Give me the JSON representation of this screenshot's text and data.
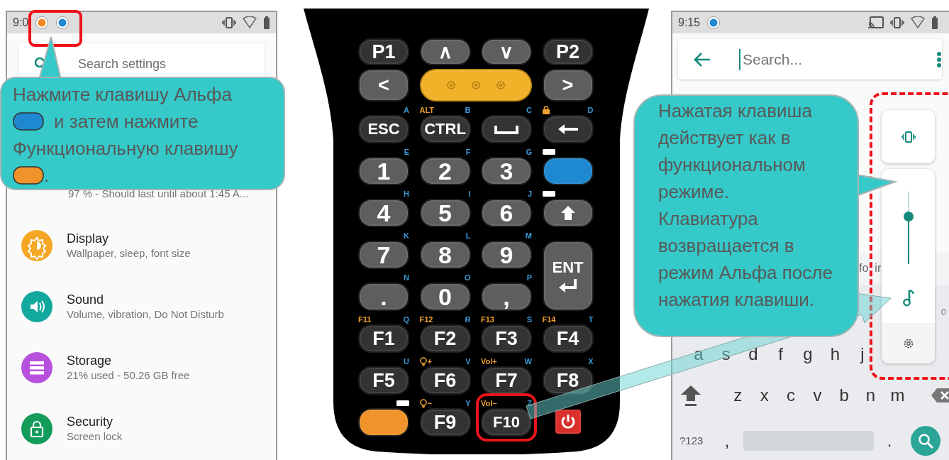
{
  "left_screen": {
    "status_bar": {
      "time": "9:0",
      "icons_highlighted": true
    },
    "search": {
      "placeholder": "Search settings"
    },
    "battery_summary": "97 % - Should last until about 1:45 A...",
    "settings": [
      {
        "kind": "display",
        "title": "Display",
        "subtitle": "Wallpaper, sleep, font size",
        "color": "#f5a623"
      },
      {
        "kind": "sound",
        "title": "Sound",
        "subtitle": "Volume, vibration, Do Not Disturb",
        "color": "#13a89e"
      },
      {
        "kind": "storage",
        "title": "Storage",
        "subtitle": "21% used - 50.26 GB free",
        "color": "#b751dd"
      },
      {
        "kind": "security",
        "title": "Security",
        "subtitle": "Screen lock",
        "color": "#149c5a"
      }
    ]
  },
  "callout_left": {
    "parts": [
      {
        "kind": "text",
        "text": "Нажмите клавишу Альфа"
      },
      {
        "kind": "key",
        "color": "#1e88d0"
      },
      {
        "kind": "text",
        "text": "и затем нажмите"
      },
      {
        "kind": "text",
        "text": "Функциональную клавишу"
      },
      {
        "kind": "key",
        "color": "#f0932b"
      },
      {
        "kind": "text",
        "text": "."
      }
    ]
  },
  "keypad": {
    "rows": [
      [
        {
          "kind": "text",
          "color": "#333333",
          "label": "P1"
        },
        {
          "kind": "text",
          "color": "#5e5e5e",
          "label": "∧"
        },
        {
          "kind": "text",
          "color": "#5e5e5e",
          "label": "∨"
        },
        {
          "kind": "text",
          "color": "#333333",
          "label": "P2"
        }
      ],
      [
        {
          "kind": "text",
          "color": "#5e5e5e",
          "label": "<"
        },
        {
          "kind": "grille",
          "color": "#f1b22a"
        },
        "",
        {
          "kind": "text",
          "color": "#5e5e5e",
          "label": ">"
        }
      ],
      [
        {
          "kind": "text",
          "color": "#333333",
          "label": "ESC",
          "letter": "A"
        },
        {
          "kind": "text",
          "color": "#333333",
          "label": "CTRL",
          "fn": "ALT",
          "letter": "B"
        },
        {
          "kind": "space",
          "color": "#333333",
          "letter": "C"
        },
        {
          "kind": "backspace",
          "color": "#333333",
          "lock": true,
          "letter": "D"
        }
      ],
      [
        {
          "kind": "text",
          "color": "#5e5e5e",
          "label": "1",
          "letter": "E"
        },
        {
          "kind": "text",
          "color": "#5e5e5e",
          "label": "2",
          "letter": "F"
        },
        {
          "kind": "text",
          "color": "#5e5e5e",
          "label": "3",
          "letter": "G"
        },
        {
          "kind": "blank",
          "color": "#1e88d0",
          "indicator": true
        }
      ],
      [
        {
          "kind": "text",
          "color": "#5e5e5e",
          "label": "4",
          "letter": "H"
        },
        {
          "kind": "text",
          "color": "#5e5e5e",
          "label": "5",
          "letter": "I"
        },
        {
          "kind": "text",
          "color": "#5e5e5e",
          "label": "6",
          "letter": "J"
        },
        {
          "kind": "shift",
          "color": "#5e5e5e",
          "indicator": true
        }
      ],
      [
        {
          "kind": "text",
          "color": "#5e5e5e",
          "label": "7",
          "letter": "K"
        },
        {
          "kind": "text",
          "color": "#5e5e5e",
          "label": "8",
          "letter": "L"
        },
        {
          "kind": "text",
          "color": "#5e5e5e",
          "label": "9",
          "letter": "M"
        },
        {
          "kind": "enter",
          "color": "#5e5e5e",
          "label": "ENT"
        }
      ],
      [
        {
          "kind": "text",
          "color": "#5e5e5e",
          "label": ".",
          "letter": "N"
        },
        {
          "kind": "text",
          "color": "#5e5e5e",
          "label": "0",
          "letter": "O"
        },
        {
          "kind": "text",
          "color": "#5e5e5e",
          "label": ",",
          "letter": "P"
        },
        ""
      ],
      [
        {
          "kind": "text",
          "color": "#333333",
          "label": "F1",
          "fn": "F11",
          "letter": "Q"
        },
        {
          "kind": "text",
          "color": "#333333",
          "label": "F2",
          "fn": "F12",
          "letter": "R"
        },
        {
          "kind": "text",
          "color": "#333333",
          "label": "F3",
          "fn": "F13",
          "letter": "S"
        },
        {
          "kind": "text",
          "color": "#333333",
          "label": "F4",
          "fn": "F14",
          "letter": "T"
        }
      ],
      [
        {
          "kind": "text",
          "color": "#333333",
          "label": "F5",
          "letter": "U"
        },
        {
          "kind": "text",
          "color": "#333333",
          "label": "F6",
          "bulb": true,
          "fn": "+",
          "letter": "V"
        },
        {
          "kind": "text",
          "color": "#333333",
          "label": "F7",
          "fn": "Vol+",
          "letter": "W"
        },
        {
          "kind": "text",
          "color": "#333333",
          "label": "F8",
          "letter": "X"
        }
      ],
      [
        {
          "kind": "blank",
          "color": "#f0932b",
          "indicator": true
        },
        {
          "kind": "text",
          "color": "#333333",
          "label": "F9",
          "bulb": true,
          "fn": "−",
          "letter": "Y"
        },
        {
          "kind": "text",
          "color": "#333333",
          "label": "F10",
          "fn": "Vol−",
          "letter": "Z",
          "highlighted": true
        },
        {
          "kind": "power",
          "color": "#d9302c"
        }
      ]
    ]
  },
  "right_screen": {
    "status_bar": {
      "time": "9:15"
    },
    "search": {
      "placeholder": "Search..."
    },
    "suggestion_fragments": [
      "fo",
      "ir"
    ],
    "key_hint": "0",
    "volume_panel": {
      "highlighted": true,
      "level": 0.66
    },
    "keyboard": {
      "middle_row": [
        "a",
        "s",
        "d",
        "f",
        "g",
        "h",
        "j"
      ],
      "bottom_row": [
        "z",
        "x",
        "c",
        "v",
        "b",
        "n",
        "m"
      ],
      "symbols_key": "?123",
      "comma_key": ",",
      "period_key": "."
    }
  },
  "callout_right": {
    "paragraphs": [
      "Нажатая клавиша действует как в функциональном режиме.",
      "Клавиатура возвращается в режим Альфа после нажатия клавиши."
    ]
  }
}
